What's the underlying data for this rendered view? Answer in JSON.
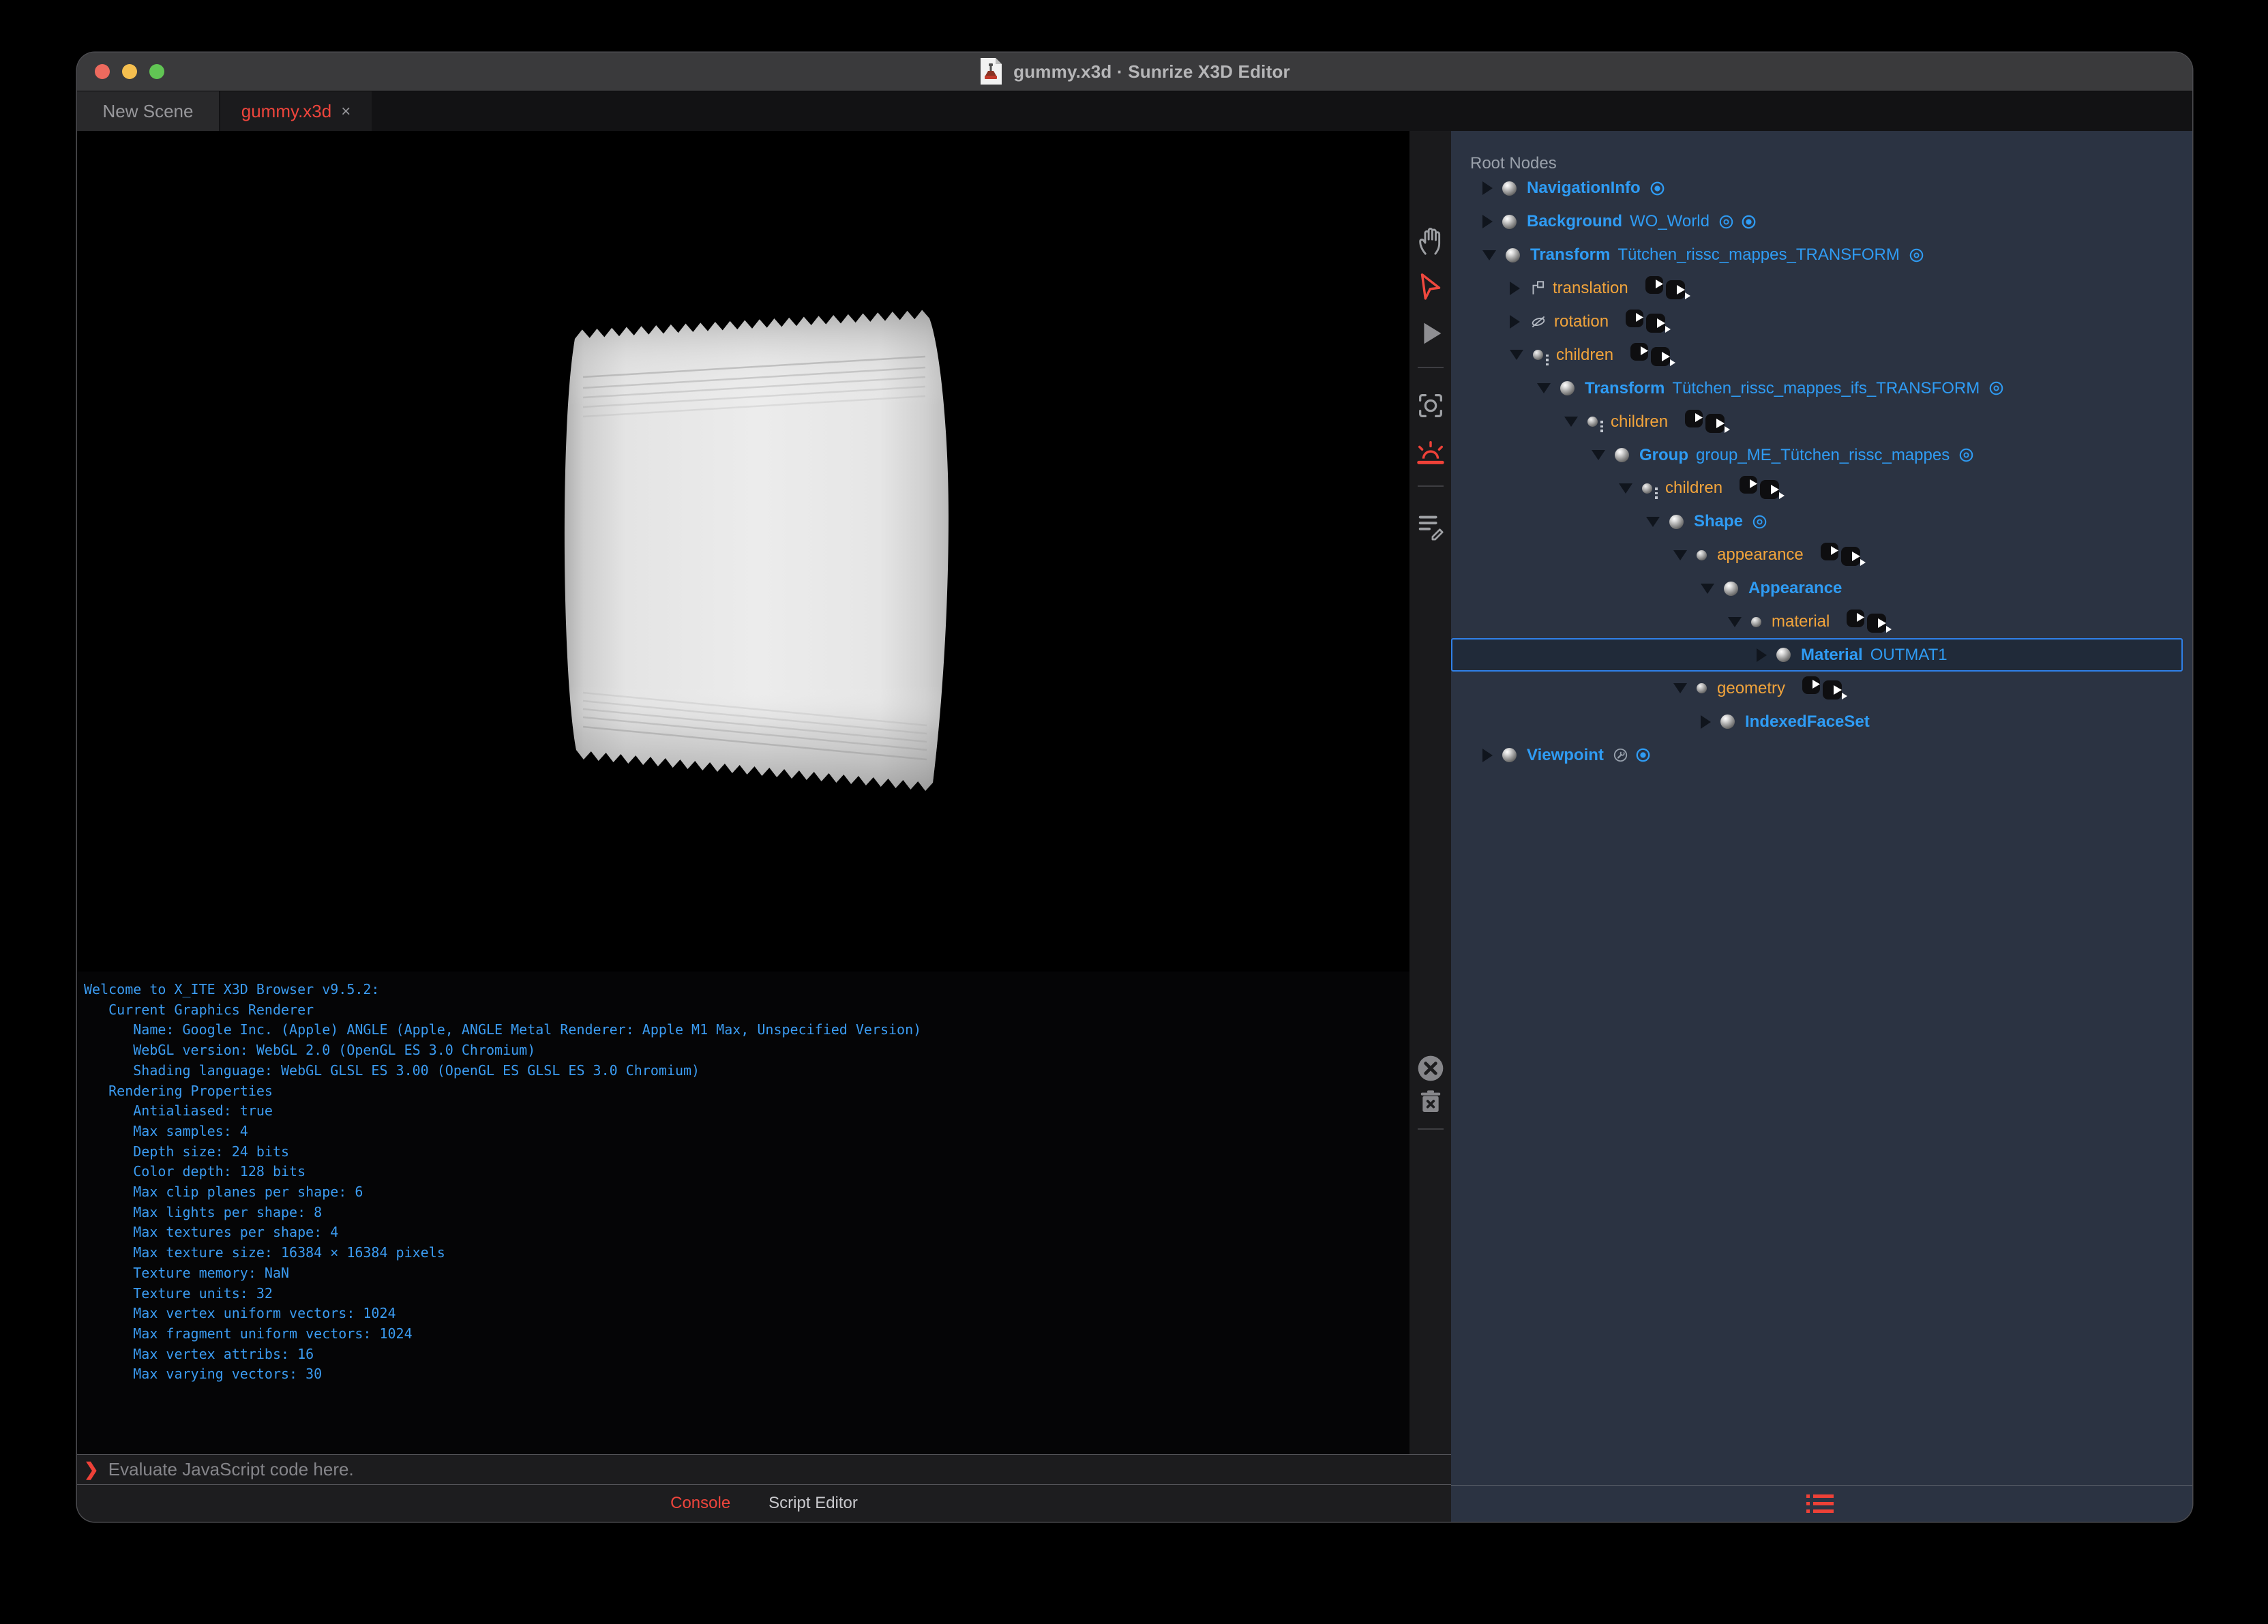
{
  "window": {
    "title": "gummy.x3d · Sunrize X3D Editor",
    "app_icon": "x3d-document-stamp-icon"
  },
  "tabs": [
    {
      "label": "New Scene",
      "active": false
    },
    {
      "label": "gummy.x3d",
      "close": "×",
      "active": true
    }
  ],
  "viewport": {
    "object": "white flow-wrap gummy packet with serrated edges"
  },
  "viewport_toolbar": [
    {
      "icon": "hand-pan-icon",
      "active": false
    },
    {
      "icon": "select-arrow-icon",
      "active": true
    },
    {
      "icon": "play-icon",
      "active": false
    },
    {
      "icon": "camera-center-icon",
      "active": false
    },
    {
      "icon": "sunrise-icon",
      "active": true
    },
    {
      "icon": "script-edit-icon",
      "active": false
    }
  ],
  "outline": {
    "header": "Root Nodes",
    "rows": [
      {
        "type": "node",
        "level": 0,
        "expand": "closed",
        "name": "NavigationInfo",
        "def": "",
        "badges": [
          "bound"
        ],
        "selected": false
      },
      {
        "type": "node",
        "level": 0,
        "expand": "closed",
        "name": "Background",
        "def": "WO_World",
        "badges": [
          "eye",
          "bound"
        ],
        "selected": false
      },
      {
        "type": "node",
        "level": 0,
        "expand": "open",
        "name": "Transform",
        "def": "Tütchen_rissc_mappes_TRANSFORM",
        "badges": [
          "eye"
        ],
        "selected": false
      },
      {
        "type": "field",
        "level": 1,
        "expand": "closed",
        "name": "translation",
        "icon": "translation",
        "routes": true
      },
      {
        "type": "field",
        "level": 1,
        "expand": "closed",
        "name": "rotation",
        "icon": "rotation",
        "routes": true
      },
      {
        "type": "field",
        "level": 1,
        "expand": "open",
        "name": "children",
        "icon": "children",
        "routes": true
      },
      {
        "type": "node",
        "level": 2,
        "expand": "open",
        "name": "Transform",
        "def": "Tütchen_rissc_mappes_ifs_TRANSFORM",
        "badges": [
          "eye"
        ],
        "selected": false
      },
      {
        "type": "field",
        "level": 3,
        "expand": "open",
        "name": "children",
        "icon": "children",
        "routes": true
      },
      {
        "type": "node",
        "level": 4,
        "expand": "open",
        "name": "Group",
        "def": "group_ME_Tütchen_rissc_mappes",
        "badges": [
          "eye"
        ],
        "selected": false
      },
      {
        "type": "field",
        "level": 5,
        "expand": "open",
        "name": "children",
        "icon": "children",
        "routes": true
      },
      {
        "type": "node",
        "level": 6,
        "expand": "open",
        "name": "Shape",
        "def": "",
        "badges": [
          "eye"
        ],
        "selected": false
      },
      {
        "type": "field",
        "level": 7,
        "expand": "open",
        "name": "appearance",
        "icon": "sfnode",
        "routes": true
      },
      {
        "type": "node",
        "level": 8,
        "expand": "open",
        "name": "Appearance",
        "def": "",
        "badges": [],
        "selected": false
      },
      {
        "type": "field",
        "level": 9,
        "expand": "open",
        "name": "material",
        "icon": "sfnode",
        "routes": true
      },
      {
        "type": "node",
        "level": 10,
        "expand": "closed",
        "name": "Material",
        "def": "OUTMAT1",
        "badges": [],
        "selected": true
      },
      {
        "type": "field",
        "level": 7,
        "expand": "open",
        "name": "geometry",
        "icon": "sfnode",
        "routes": true
      },
      {
        "type": "node",
        "level": 8,
        "expand": "closed",
        "name": "IndexedFaceSet",
        "def": "",
        "badges": [],
        "selected": false
      },
      {
        "type": "node",
        "level": 0,
        "expand": "closed",
        "name": "Viewpoint",
        "def": "",
        "badges": [
          "tool",
          "bound"
        ],
        "selected": false
      }
    ]
  },
  "console": {
    "lines": [
      "Welcome to X_ITE X3D Browser v9.5.2:",
      "   Current Graphics Renderer",
      "      Name: Google Inc. (Apple) ANGLE (Apple, ANGLE Metal Renderer: Apple M1 Max, Unspecified Version)",
      "      WebGL version: WebGL 2.0 (OpenGL ES 3.0 Chromium)",
      "      Shading language: WebGL GLSL ES 3.00 (OpenGL ES GLSL ES 3.0 Chromium)",
      "   Rendering Properties",
      "      Antialiased: true",
      "      Max samples: 4",
      "      Depth size: 24 bits",
      "      Color depth: 128 bits",
      "      Max clip planes per shape: 6",
      "      Max lights per shape: 8",
      "      Max textures per shape: 4",
      "      Max texture size: 16384 × 16384 pixels",
      "      Texture memory: NaN",
      "      Texture units: 32",
      "      Max vertex uniform vectors: 1024",
      "      Max fragment uniform vectors: 1024",
      "      Max vertex attribs: 16",
      "      Max varying vectors: 30"
    ],
    "prompt": "❯",
    "placeholder": "Evaluate JavaScript code here.",
    "tabs": [
      {
        "label": "Console",
        "active": true
      },
      {
        "label": "Script Editor",
        "active": false
      }
    ]
  },
  "colors": {
    "accent_red": "#ef453c",
    "node_blue": "#2f9cf4",
    "field_orange": "#f2a43b",
    "panel_bg": "#2b3342",
    "titlebar_bg": "#3a3a3c",
    "console_text": "#3b9cf2",
    "selection_border": "#2f80e8"
  }
}
